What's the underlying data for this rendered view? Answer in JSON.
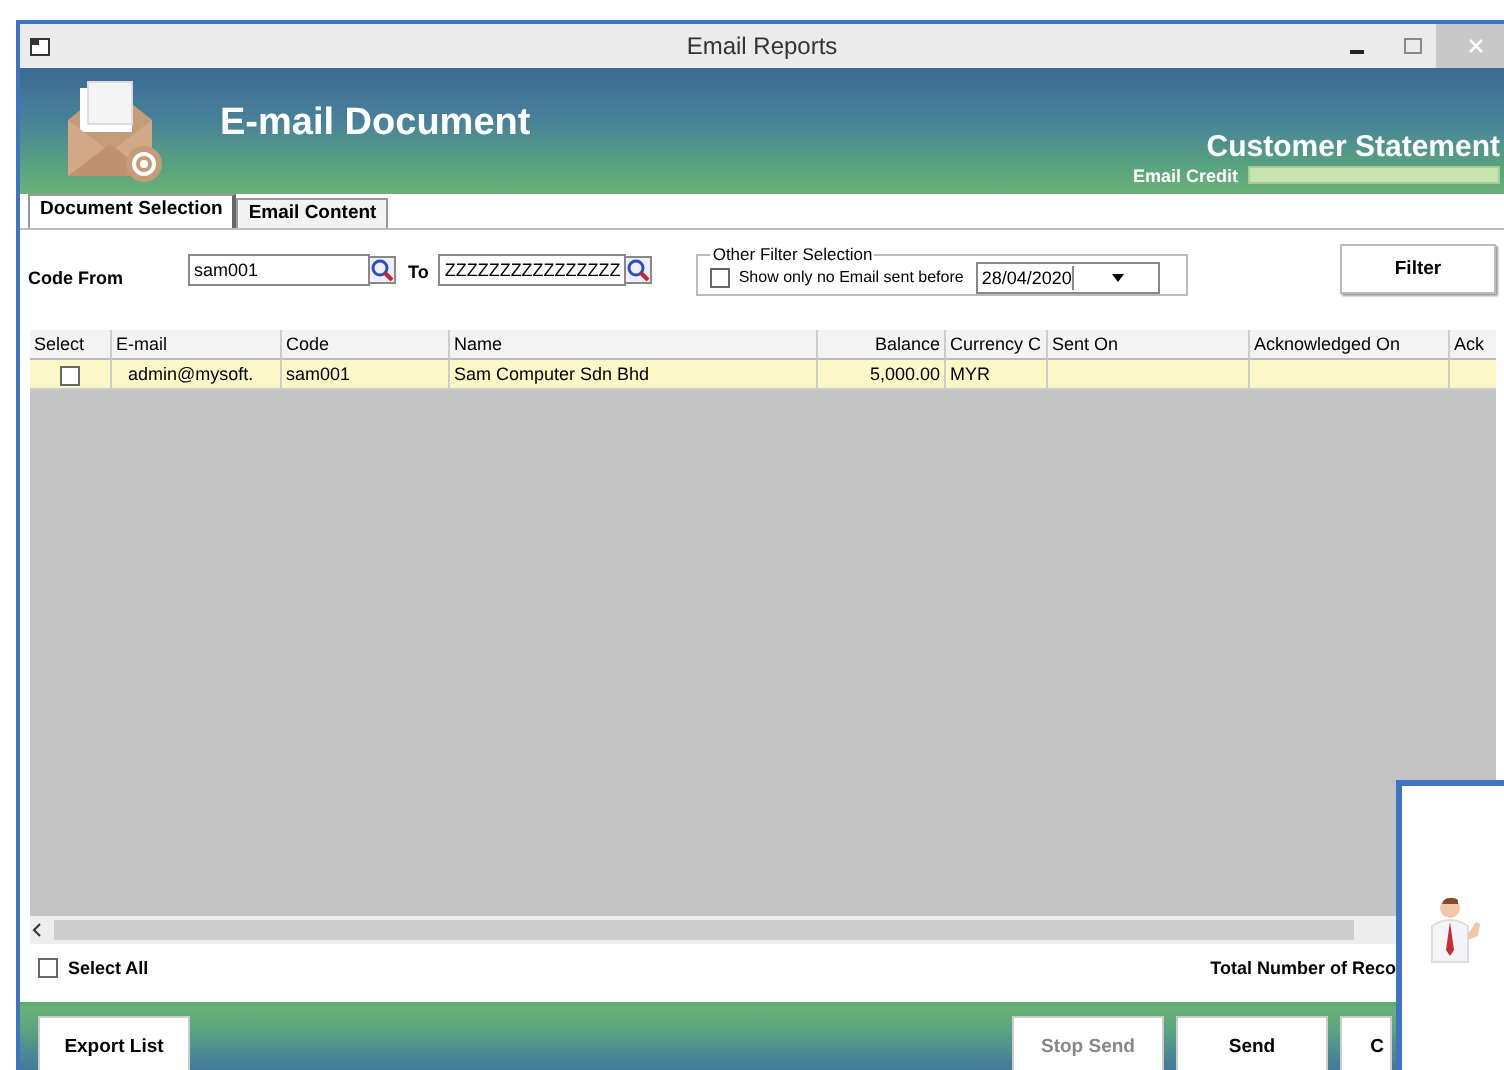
{
  "window": {
    "title": "Email Reports"
  },
  "header": {
    "title": "E-mail Document",
    "report": "Customer Statement",
    "credit_label": "Email Credit"
  },
  "tabs": [
    {
      "label": "Document Selection",
      "selected": true
    },
    {
      "label": "Email Content",
      "selected": false
    }
  ],
  "filter": {
    "code_from_label": "Code From",
    "code_from": "sam001",
    "to_label": "To",
    "code_to": "ZZZZZZZZZZZZZZZZ",
    "other_legend": "Other Filter Selection",
    "no_email_label": "Show only no Email sent before",
    "no_email_checked": false,
    "date": "28/04/2020",
    "filter_button": "Filter"
  },
  "table": {
    "columns": [
      "Select",
      "E-mail",
      "Code",
      "Name",
      "Balance",
      "Currency C",
      "Sent On",
      "Acknowledged On",
      "Ack"
    ],
    "rows": [
      {
        "checked": false,
        "selected": true,
        "cells": [
          "",
          "admin@mysoft.",
          "sam001",
          "Sam Computer Sdn Bhd",
          "5,000.00",
          "MYR",
          "",
          "",
          ""
        ]
      }
    ]
  },
  "select_all": {
    "label": "Select All",
    "checked": false
  },
  "total_label": "Total Number of Reco",
  "buttons": [
    {
      "label": "Export List",
      "disabled": false
    },
    {
      "label": "Stop Send",
      "disabled": true
    },
    {
      "label": "Send",
      "disabled": false
    },
    {
      "label": "C",
      "disabled": false
    }
  ]
}
